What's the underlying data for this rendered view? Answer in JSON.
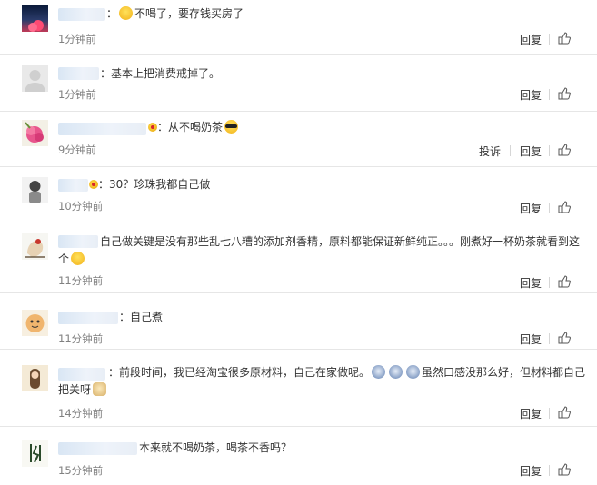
{
  "actions": {
    "reply": "回复",
    "report": "投诉"
  },
  "comments": [
    {
      "content": "不喝了，要存钱买房了",
      "time": "1分钟前"
    },
    {
      "content": "基本上把消费戒掉了。",
      "time": "1分钟前"
    },
    {
      "content": "从不喝奶茶",
      "time": "9分钟前"
    },
    {
      "content": "30？珍珠我都自己做",
      "time": "10分钟前"
    },
    {
      "content": "自己做关键是没有那些乱七八糟的添加剂香精，原料都能保证新鲜纯正。。。刚煮好一杯奶茶就看到这个",
      "time": "11分钟前"
    },
    {
      "content": "自己煮",
      "time": "11分钟前"
    },
    {
      "content_a": "前段时间，我已经淘宝很多原材料，自己在家做呢。",
      "content_b": "虽然口感没那么好，但材料都自己把关呀",
      "time": "14分钟前"
    },
    {
      "content": "本来就不喝奶茶，喝茶不香吗？",
      "time": "15分钟前"
    }
  ],
  "colors": {
    "link": "#333333",
    "time": "#808080",
    "divider": "#e6e6e6",
    "name_blur": "#dde8f5"
  },
  "icons": {
    "like": "thumbs-up-icon",
    "emoji_laugh": "laugh-emoji",
    "emoji_cool": "sunglasses-emoji",
    "emoji_smile": "smile-emoji",
    "emoji_doge": "doge-emoji",
    "emoji_cry": "crying-emoji"
  }
}
